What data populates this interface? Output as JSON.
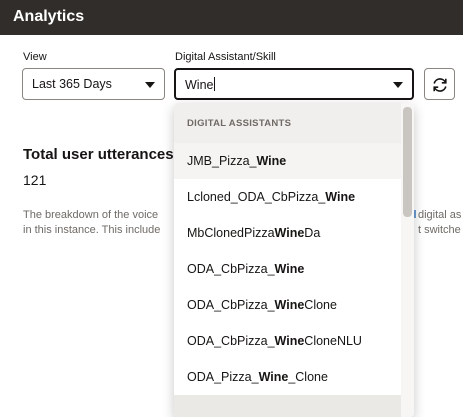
{
  "header": {
    "title": "Analytics"
  },
  "filters": {
    "view_label": "View",
    "view_value": "Last 365 Days",
    "assistant_label": "Digital Assistant/Skill",
    "assistant_input_value": "Wine",
    "refresh_icon": "refresh-icon"
  },
  "summary": {
    "title": "Total user utterances",
    "count": "121",
    "description_line1_left": "The breakdown of the voice",
    "description_line2_left": "in this instance. This include",
    "description_line1_right": "digital as",
    "description_line2_right": "t switche"
  },
  "dropdown": {
    "group_label": "DIGITAL ASSISTANTS",
    "items": [
      {
        "prefix": "JMB_Pizza_",
        "match": "Wine",
        "suffix": ""
      },
      {
        "prefix": "Lcloned_ODA_CbPizza_",
        "match": "Wine",
        "suffix": ""
      },
      {
        "prefix": "MbClonedPizza",
        "match": "Wine",
        "suffix": "Da"
      },
      {
        "prefix": "ODA_CbPizza_",
        "match": "Wine",
        "suffix": ""
      },
      {
        "prefix": "ODA_CbPizza_",
        "match": "Wine",
        "suffix": "Clone"
      },
      {
        "prefix": "ODA_CbPizza_",
        "match": "Wine",
        "suffix": "CloneNLU"
      },
      {
        "prefix": "ODA_Pizza_",
        "match": "Wine",
        "suffix": "_Clone"
      }
    ]
  },
  "colors": {
    "header_bg": "#312d2a",
    "chart_wedge": "#c47b7b",
    "scroll_thumb": "#c9c6c2"
  }
}
